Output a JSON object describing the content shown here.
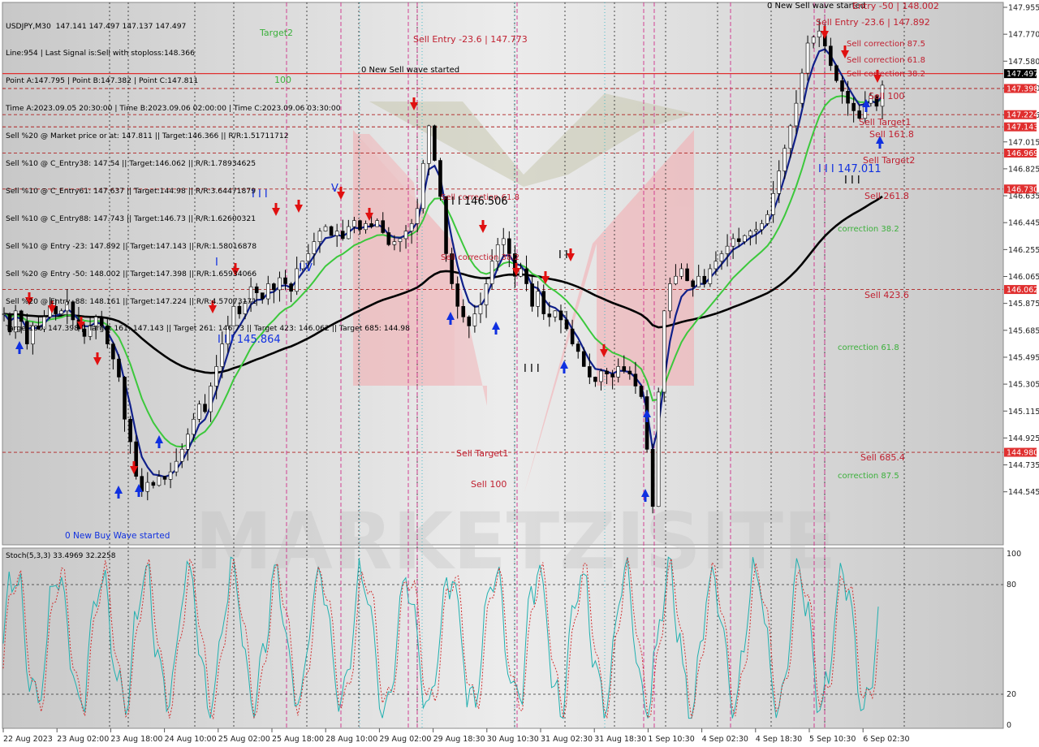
{
  "chart_data": {
    "type": "candlestick",
    "symbol_line": "USDJPY,M30  147.141 147.497 147.137 147.497",
    "info_lines": [
      "Line:954 | Last Signal is:Sell with stoploss:148.366",
      "Point A:147.795 | Point B:147.382 | Point C:147.811",
      "Time A:2023.09.05 20:30:00 | Time B:2023.09.06 02:00:00 | Time C:2023.09.06 03:30:00",
      "Sell %20 @ Market price or at: 147.811 || Target:146.366 || R/R:1.51711712",
      "Sell %10 @ C_Entry38: 147.54 || Target:146.062 || R/R:1.78934625",
      "Sell %10 @ C_Entry61: 147.637 || Target:144.98 || R/R:3.64471879",
      "Sell %10 @ C_Entry88: 147.743 || Target:146.73 || R/R:1.62600321",
      "Sell %10 @ Entry -23: 147.892 || Target:147.143 || R/R:1.58016878",
      "Sell %20 @ Entry -50: 148.002 || Target:147.398 || R/R:1.65934066",
      "Sell %20 @ Entry -88: 148.161 || Target:147.224 || R/R:4.57073171",
      "Target100: 147.398 || Target 161: 147.143 || Target 261: 146.73 || Target 423: 146.062 || Target 685: 144.98"
    ],
    "y_ticks": [
      "147.955",
      "147.770",
      "147.580",
      "147.390",
      "147.205",
      "147.015",
      "146.825",
      "146.635",
      "146.445",
      "146.255",
      "146.065",
      "145.875",
      "145.685",
      "145.495",
      "145.305",
      "145.115",
      "144.925",
      "144.735",
      "144.545"
    ],
    "price_tags": [
      {
        "label": "147.497",
        "value": 147.497,
        "color": "#000000"
      },
      {
        "label": "147.398",
        "value": 147.398,
        "color": "#e03030"
      },
      {
        "label": "147.224",
        "value": 147.224,
        "color": "#e03030"
      },
      {
        "label": "147.143",
        "value": 147.143,
        "color": "#e03030"
      },
      {
        "label": "146.969",
        "value": 146.969,
        "color": "#e03030"
      },
      {
        "label": "146.730",
        "value": 146.73,
        "color": "#e03030"
      },
      {
        "label": "146.062",
        "value": 146.062,
        "color": "#e03030"
      },
      {
        "label": "144.980",
        "value": 144.98,
        "color": "#e03030"
      }
    ],
    "x_ticks": [
      "22 Aug 2023",
      "23 Aug 02:00",
      "23 Aug 18:00",
      "24 Aug 10:00",
      "25 Aug 02:00",
      "25 Aug 18:00",
      "28 Aug 10:00",
      "29 Aug 02:00",
      "29 Aug 18:30",
      "30 Aug 10:30",
      "31 Aug 02:30",
      "31 Aug 18:30",
      "1 Sep 10:30",
      "4 Sep 02:30",
      "4 Sep 18:30",
      "5 Sep 10:30",
      "6 Sep 02:30"
    ],
    "close_series": [
      145.9,
      145.78,
      145.92,
      145.85,
      145.7,
      145.82,
      145.8,
      145.88,
      145.95,
      145.9,
      145.92,
      145.98,
      145.86,
      145.8,
      145.75,
      145.82,
      145.88,
      145.82,
      145.7,
      145.6,
      145.48,
      145.2,
      145.05,
      144.82,
      144.72,
      144.78,
      144.76,
      144.82,
      144.8,
      144.85,
      144.92,
      145.0,
      145.1,
      145.2,
      145.3,
      145.25,
      145.42,
      145.55,
      145.7,
      145.82,
      145.95,
      145.9,
      145.98,
      146.08,
      146.04,
      146.0,
      146.1,
      146.06,
      146.14,
      146.1,
      146.05,
      146.2,
      146.25,
      146.3,
      146.38,
      146.45,
      146.48,
      146.42,
      146.45,
      146.4,
      146.48,
      146.52,
      146.46,
      146.5,
      146.48,
      146.52,
      146.44,
      146.36,
      146.38,
      146.4,
      146.45,
      146.5,
      146.6,
      146.9,
      147.15,
      146.92,
      146.68,
      146.3,
      146.1,
      145.95,
      145.88,
      145.82,
      145.9,
      145.96,
      146.1,
      146.25,
      146.36,
      146.4,
      146.3,
      146.15,
      146.2,
      146.1,
      145.95,
      146.05,
      145.9,
      145.88,
      145.92,
      145.86,
      145.8,
      145.7,
      145.65,
      145.55,
      145.48,
      145.45,
      145.52,
      145.5,
      145.48,
      145.55,
      145.52,
      145.5,
      145.42,
      145.35,
      145.0,
      144.62,
      145.38,
      145.92,
      146.1,
      146.15,
      146.2,
      146.12,
      146.08,
      146.15,
      146.1,
      146.2,
      146.25,
      146.3,
      146.35,
      146.4,
      146.38,
      146.42,
      146.45,
      146.46,
      146.5,
      146.56,
      146.7,
      146.85,
      147.0,
      147.15,
      147.3,
      147.5,
      147.7,
      147.74,
      147.78,
      147.68,
      147.55,
      147.45,
      147.38,
      147.3,
      147.25,
      147.2,
      147.3,
      147.35,
      147.28,
      147.42
    ]
  }
}
